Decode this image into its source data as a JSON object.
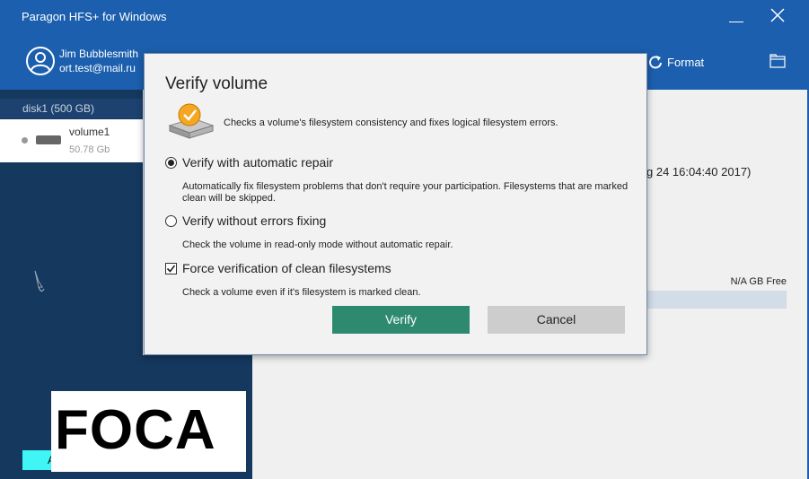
{
  "window": {
    "title": "Paragon HFS+ for Windows"
  },
  "header": {
    "user_name": "Jim Bubblesmith",
    "user_email": "ort.test@mail.ru",
    "format_label": "Format",
    "user_icon": "user-circle-icon",
    "format_icon": "format-refresh-icon",
    "folder_icon": "folder-icon"
  },
  "sidebar": {
    "disk_label": "disk1 (500 GB)",
    "volume": {
      "name": "volume1",
      "size": "50.78 Gb"
    },
    "bottom_button_label": "A"
  },
  "content": {
    "date_fragment": "g 24 16:04:40 2017)",
    "free_label": "N/A GB Free"
  },
  "dialog": {
    "title": "Verify volume",
    "description": "Checks a volume's filesystem consistency and fixes logical filesystem errors.",
    "options": [
      {
        "label": "Verify with automatic repair",
        "description": "Automatically fix filesystem problems that don't require your participation. Filesystems that are marked clean will be skipped.",
        "selected": true
      },
      {
        "label": "Verify without errors fixing",
        "description": "Check the volume in read-only mode without automatic repair.",
        "selected": false
      }
    ],
    "force_check": {
      "label": "Force verification of clean filesystems",
      "description": "Check a volume even if it's filesystem is marked clean.",
      "checked": true
    },
    "verify_label": "Verify",
    "cancel_label": "Cancel"
  },
  "watermark": {
    "text": "FOCA"
  },
  "colors": {
    "titlebar": "#1b5fae",
    "sidebar": "#15385f",
    "verify_button": "#2e8a6e",
    "cancel_button": "#cdcdcd"
  }
}
